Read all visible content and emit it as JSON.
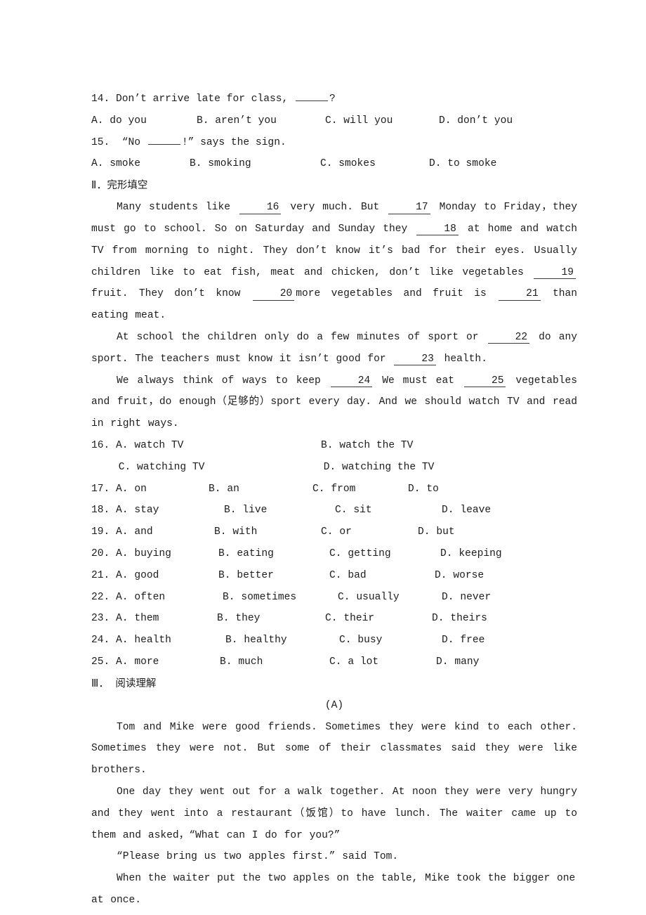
{
  "document": {
    "type": "english-exam-worksheet",
    "background_color": "#ffffff",
    "text_color": "#1c1c1c"
  },
  "grammar_questions": [
    {
      "number": "14.",
      "stem_before": "Don’t arrive late for class, ",
      "stem_blank": "",
      "stem_after": "?",
      "options": [
        {
          "letter": "A.",
          "text": "do you"
        },
        {
          "letter": "B.",
          "text": "aren’t you"
        },
        {
          "letter": "C.",
          "text": "will you"
        },
        {
          "letter": "D.",
          "text": "don’t you"
        }
      ]
    },
    {
      "number": "15.",
      "stem_before": "“No ",
      "stem_blank": "",
      "stem_after": "!” says the sign.",
      "options": [
        {
          "letter": "A.",
          "text": "smoke"
        },
        {
          "letter": "B.",
          "text": "smoking"
        },
        {
          "letter": "C.",
          "text": "smokes"
        },
        {
          "letter": "D.",
          "text": "to smoke"
        }
      ]
    }
  ],
  "section_two": {
    "numeral": "Ⅱ．",
    "title_cjk": "完形填空",
    "paragraphs": [
      {
        "segments": [
          {
            "type": "text",
            "value": "Many students like "
          },
          {
            "type": "blank",
            "value": "16"
          },
          {
            "type": "text",
            "value": " very much. But "
          },
          {
            "type": "blank",
            "value": "17"
          },
          {
            "type": "text",
            "value": " Monday to Friday，they must go to school. So on Saturday and Sunday they "
          },
          {
            "type": "blank",
            "value": "18"
          },
          {
            "type": "text",
            "value": " at home and watch TV from morning to night. They don’t know it’s bad for their eyes. Usually children like to eat fish, meat and chicken, don’t like vegetables "
          },
          {
            "type": "blank",
            "value": "19"
          },
          {
            "type": "text",
            "value": " fruit. They don’t know "
          },
          {
            "type": "blank",
            "value": "20"
          },
          {
            "type": "text",
            "value": "more vegetables and fruit is "
          },
          {
            "type": "blank",
            "value": "21"
          },
          {
            "type": "text",
            "value": " than eating meat."
          }
        ]
      },
      {
        "segments": [
          {
            "type": "text",
            "value": "At school the children only do a few minutes of sport or "
          },
          {
            "type": "blank",
            "value": "22"
          },
          {
            "type": "text",
            "value": " do any sport. The teachers must know it isn’t good for "
          },
          {
            "type": "blank",
            "value": "23"
          },
          {
            "type": "text",
            "value": " health."
          }
        ]
      },
      {
        "segments": [
          {
            "type": "text",
            "value": "We always think of ways to keep "
          },
          {
            "type": "blank",
            "value": "24"
          },
          {
            "type": "text",
            "value": " We must eat "
          },
          {
            "type": "blank",
            "value": "25"
          },
          {
            "type": "text",
            "value": " vegetables and fruit，do enough（足够的）sport every day. And we should watch TV and read in right ways."
          }
        ]
      }
    ],
    "questions": [
      {
        "number": "16.",
        "layout": "two-line",
        "options": [
          {
            "letter": "A.",
            "text": "watch TV"
          },
          {
            "letter": "B.",
            "text": "watch the TV"
          },
          {
            "letter": "C.",
            "text": "watching TV"
          },
          {
            "letter": "D.",
            "text": "watching the TV"
          }
        ]
      },
      {
        "number": "17.",
        "layout": "one-line",
        "options": [
          {
            "letter": "A.",
            "text": "on"
          },
          {
            "letter": "B.",
            "text": "an"
          },
          {
            "letter": "C.",
            "text": "from"
          },
          {
            "letter": "D.",
            "text": "to"
          }
        ]
      },
      {
        "number": "18.",
        "layout": "one-line",
        "options": [
          {
            "letter": "A.",
            "text": "stay"
          },
          {
            "letter": "B.",
            "text": "live"
          },
          {
            "letter": "C.",
            "text": "sit"
          },
          {
            "letter": "D.",
            "text": "leave"
          }
        ]
      },
      {
        "number": "19.",
        "layout": "one-line",
        "options": [
          {
            "letter": "A.",
            "text": "and"
          },
          {
            "letter": "B.",
            "text": "with"
          },
          {
            "letter": "C.",
            "text": "or"
          },
          {
            "letter": "D.",
            "text": "but"
          }
        ]
      },
      {
        "number": "20.",
        "layout": "one-line",
        "options": [
          {
            "letter": "A.",
            "text": "buying"
          },
          {
            "letter": "B.",
            "text": "eating"
          },
          {
            "letter": "C.",
            "text": "getting"
          },
          {
            "letter": "D.",
            "text": "keeping"
          }
        ]
      },
      {
        "number": "21.",
        "layout": "one-line",
        "options": [
          {
            "letter": "A.",
            "text": "good"
          },
          {
            "letter": "B.",
            "text": "better"
          },
          {
            "letter": "C.",
            "text": "bad"
          },
          {
            "letter": "D.",
            "text": "worse"
          }
        ]
      },
      {
        "number": "22.",
        "layout": "one-line",
        "options": [
          {
            "letter": "A.",
            "text": "often"
          },
          {
            "letter": "B.",
            "text": "sometimes"
          },
          {
            "letter": "C.",
            "text": "usually"
          },
          {
            "letter": "D.",
            "text": "never"
          }
        ]
      },
      {
        "number": "23.",
        "layout": "one-line",
        "options": [
          {
            "letter": "A.",
            "text": "them"
          },
          {
            "letter": "B.",
            "text": "they"
          },
          {
            "letter": "C.",
            "text": "their"
          },
          {
            "letter": "D.",
            "text": "theirs"
          }
        ]
      },
      {
        "number": "24.",
        "layout": "one-line",
        "options": [
          {
            "letter": "A.",
            "text": "health"
          },
          {
            "letter": "B.",
            "text": "healthy"
          },
          {
            "letter": "C.",
            "text": "busy"
          },
          {
            "letter": "D.",
            "text": "free"
          }
        ]
      },
      {
        "number": "25.",
        "layout": "one-line",
        "options": [
          {
            "letter": "A.",
            "text": "more"
          },
          {
            "letter": "B.",
            "text": "much"
          },
          {
            "letter": "C.",
            "text": "a lot"
          },
          {
            "letter": "D.",
            "text": "many"
          }
        ]
      }
    ]
  },
  "section_three": {
    "numeral": "Ⅲ．",
    "title_cjk": "阅读理解",
    "passage_label": "(A)",
    "paragraphs": [
      "Tom and Mike were good friends. Sometimes they were kind to each other. Sometimes they were not. But some of their classmates said they were like brothers.",
      "One day they went out for a walk together. At noon they were very hungry and they went into a restaurant（饭馆）to have lunch. The waiter came up to them and asked，“What can I do for you?”",
      "“Please bring us two apples first.” said Tom.",
      "When the waiter put the two apples on the table, Mike took the bigger one at once."
    ]
  }
}
